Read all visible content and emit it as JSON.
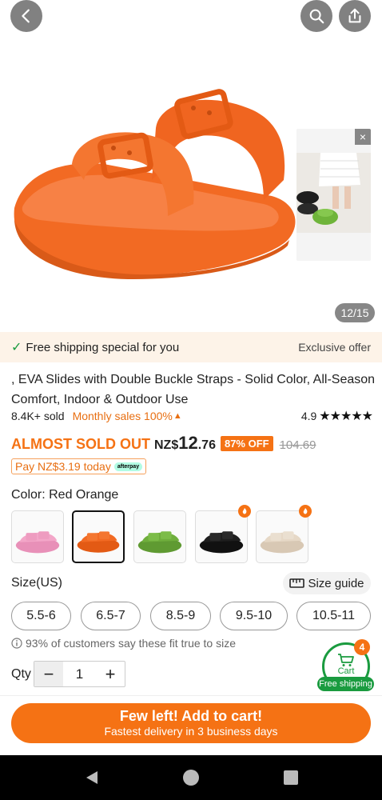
{
  "gallery": {
    "counter": "12/15",
    "close_glyph": "×",
    "icons": {
      "back": "chevron-left-icon",
      "search": "search-icon",
      "share": "share-icon"
    }
  },
  "shipping_banner": {
    "text": "Free shipping special for you",
    "offer": "Exclusive offer"
  },
  "product": {
    "title": ", EVA Slides with Double Buckle Straps - Solid Color, All-Season Comfort, Indoor & Outdoor Use",
    "sold": "8.4K+ sold",
    "monthly_sales": "Monthly sales 100%",
    "rating": "4.9",
    "stars": "★★★★★",
    "rating_value": 4.9
  },
  "price": {
    "almost_sold_out": "ALMOST SOLD OUT",
    "currency": "NZ$",
    "integer": "12",
    "decimal": ".76",
    "discount": "87% OFF",
    "original": "104.69",
    "pay_later": "Pay NZ$3.19 today",
    "afterpay_label": "afterpay"
  },
  "color": {
    "label": "Color: Red Orange",
    "swatches": [
      {
        "name": "pink",
        "hex": "#f3a6c8",
        "selected": false,
        "flag": false
      },
      {
        "name": "red orange",
        "hex": "#f26a23",
        "selected": true,
        "flag": false
      },
      {
        "name": "green",
        "hex": "#6fae3c",
        "selected": false,
        "flag": false
      },
      {
        "name": "black",
        "hex": "#1e1e1e",
        "selected": false,
        "flag": true
      },
      {
        "name": "beige",
        "hex": "#e6d8c6",
        "selected": false,
        "flag": true
      }
    ]
  },
  "size": {
    "label": "Size(US)",
    "guide": "Size guide",
    "options": [
      "5.5-6",
      "6.5-7",
      "8.5-9",
      "9.5-10",
      "10.5-11"
    ],
    "fit_note": "93% of customers say these fit true to size"
  },
  "cart": {
    "label": "Cart",
    "count": "4",
    "free_shipping": "Free shipping"
  },
  "qty": {
    "label": "Qty",
    "value": "1",
    "minus": "−",
    "plus": "+"
  },
  "add_to_cart": {
    "main": "Few left! Add to cart!",
    "sub": "Fastest delivery in 3 business days"
  },
  "colors": {
    "accent": "#f57214",
    "green": "#1a9b3f",
    "banner_bg": "#fdf3e8"
  }
}
